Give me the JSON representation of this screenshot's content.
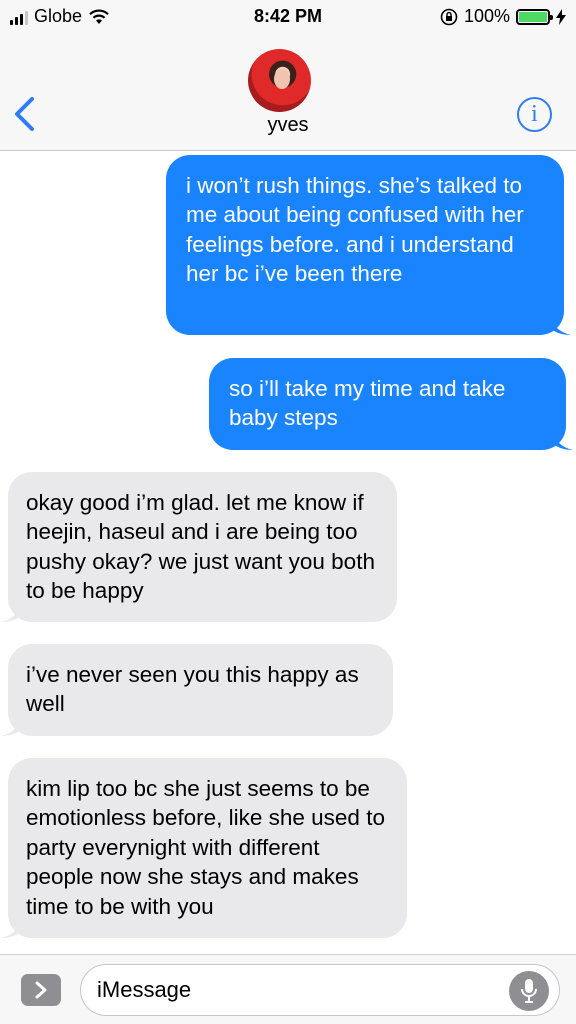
{
  "status_bar": {
    "carrier": "Globe",
    "time": "8:42 PM",
    "battery_percent": "100%",
    "battery_level": 1.0,
    "icons": [
      "signal-icon",
      "wifi-icon",
      "orientation-lock-icon",
      "battery-icon",
      "charging-bolt-icon"
    ]
  },
  "header": {
    "contact_name": "yves",
    "back_icon": "chevron-left-icon",
    "info_icon": "info-icon"
  },
  "messages": [
    {
      "direction": "outgoing",
      "text": "i won’t rush things. she’s talked to me about being confused with her feelings before. and i understand her bc i’ve been there"
    },
    {
      "direction": "outgoing",
      "text": "so i’ll take my time and take baby steps"
    },
    {
      "direction": "incoming",
      "text": "okay good i’m glad. let me know if heejin, haseul and i are being too pushy okay? we just want you both to be happy"
    },
    {
      "direction": "incoming",
      "text": "i’ve never seen you this happy as well"
    },
    {
      "direction": "incoming",
      "text": "kim lip too bc she just seems to be emotionless before, like she used to party everynight with different people now she stays and makes time to be with you"
    }
  ],
  "input": {
    "placeholder": "iMessage",
    "apps_icon": "chevron-right-icon",
    "mic_icon": "microphone-icon"
  },
  "colors": {
    "outgoing_bubble": "#1a84ff",
    "incoming_bubble": "#e9e9eb",
    "accent": "#2f7cf6",
    "battery_fill": "#4cd964"
  }
}
